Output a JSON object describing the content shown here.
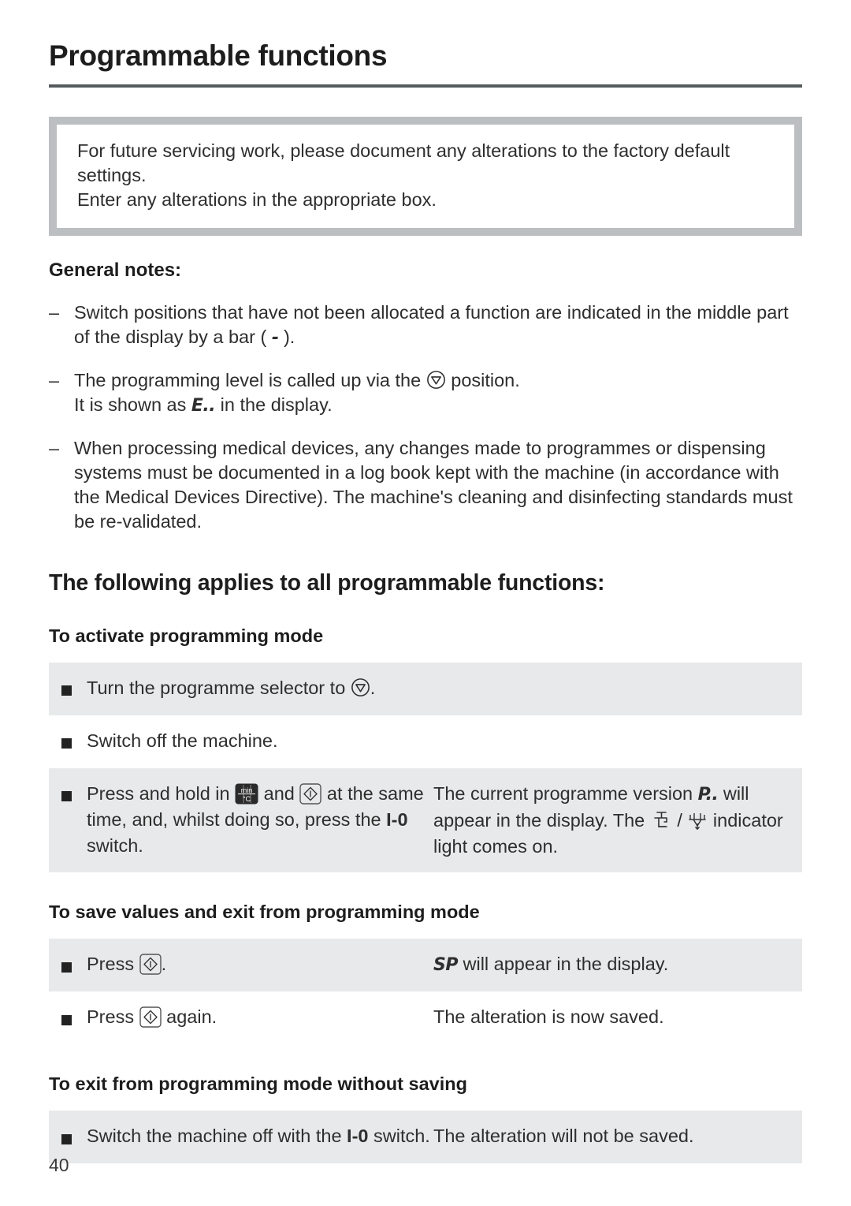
{
  "document": {
    "title": "Programmable functions",
    "page_number": "40"
  },
  "callout": {
    "lines": [
      "For future servicing work, please document any alterations to the factory default settings.",
      "Enter any alterations in the appropriate box."
    ]
  },
  "general_notes": {
    "heading": "General notes:",
    "dash_mark": "–",
    "items": [
      {
        "text_before": "Switch positions that have not been allocated a function are indicated in the middle part of the display by a bar ( ",
        "glyph": "-",
        "text_after": " )."
      },
      {
        "text_before": "The programming level is called up via the ",
        "icon": "programme-selector-position-icon",
        "text_after": " position.",
        "second_line_before": "It is shown as ",
        "display_code": "E..",
        "second_line_after": " in the display."
      },
      {
        "text_before": "When processing medical devices, any changes made to programmes or dispensing systems must be documented in a log book kept with the machine (in accordance with the Medical Devices Directive). The machine's cleaning and disinfecting standards must be re-validated."
      }
    ]
  },
  "main_section": {
    "heading": "The following applies to all programmable functions:"
  },
  "activate": {
    "heading": "To activate programming mode",
    "rows": [
      {
        "shaded": true,
        "full_width": true,
        "left_before": "Turn the programme selector to ",
        "left_icon": "programme-selector-position-icon",
        "left_after": "."
      },
      {
        "shaded": false,
        "full_width": true,
        "left_before": "Switch off the machine.",
        "left_after": ""
      },
      {
        "shaded": true,
        "full_width": false,
        "left_seg1": "Press and hold in ",
        "left_icon1": "min-celsius-button-icon",
        "left_seg2": " and ",
        "left_icon2": "start-button-icon",
        "left_seg3": " at the same time, and, whilst doing so, press the ",
        "left_bold": "I-0",
        "left_seg4": " switch.",
        "right_seg1": "The current programme version ",
        "right_display": "P..",
        "right_seg2": " will appear in the display. The ",
        "right_icon1": "water-inlet-tap-icon",
        "right_sep": " / ",
        "right_icon2": "water-drain-icon",
        "right_seg3": " indicator light comes on."
      }
    ]
  },
  "save": {
    "heading": "To save values and exit from programming mode",
    "rows": [
      {
        "shaded": true,
        "left_seg1": "Press ",
        "left_icon1": "start-button-icon",
        "left_seg2": ".",
        "right_display": "SP",
        "right_seg2": " will appear in the display."
      },
      {
        "shaded": false,
        "left_seg1": "Press ",
        "left_icon1": "start-button-icon",
        "left_seg2": " again.",
        "right_seg1": "The alteration is now saved."
      }
    ]
  },
  "exit": {
    "heading": "To exit from programming mode without saving",
    "rows": [
      {
        "shaded": true,
        "left_seg1": "Switch the machine off with the ",
        "left_bold": "I-0",
        "left_seg2": " switch.",
        "right_seg1": "The alteration will not be saved."
      }
    ]
  },
  "colors": {
    "text": "#2e2e2e",
    "heading": "#1d1d1d",
    "rule": "#555a5d",
    "callout_border": "#bcbfc1",
    "table_shade": "#e8e9ea",
    "page_background": "#ffffff"
  }
}
